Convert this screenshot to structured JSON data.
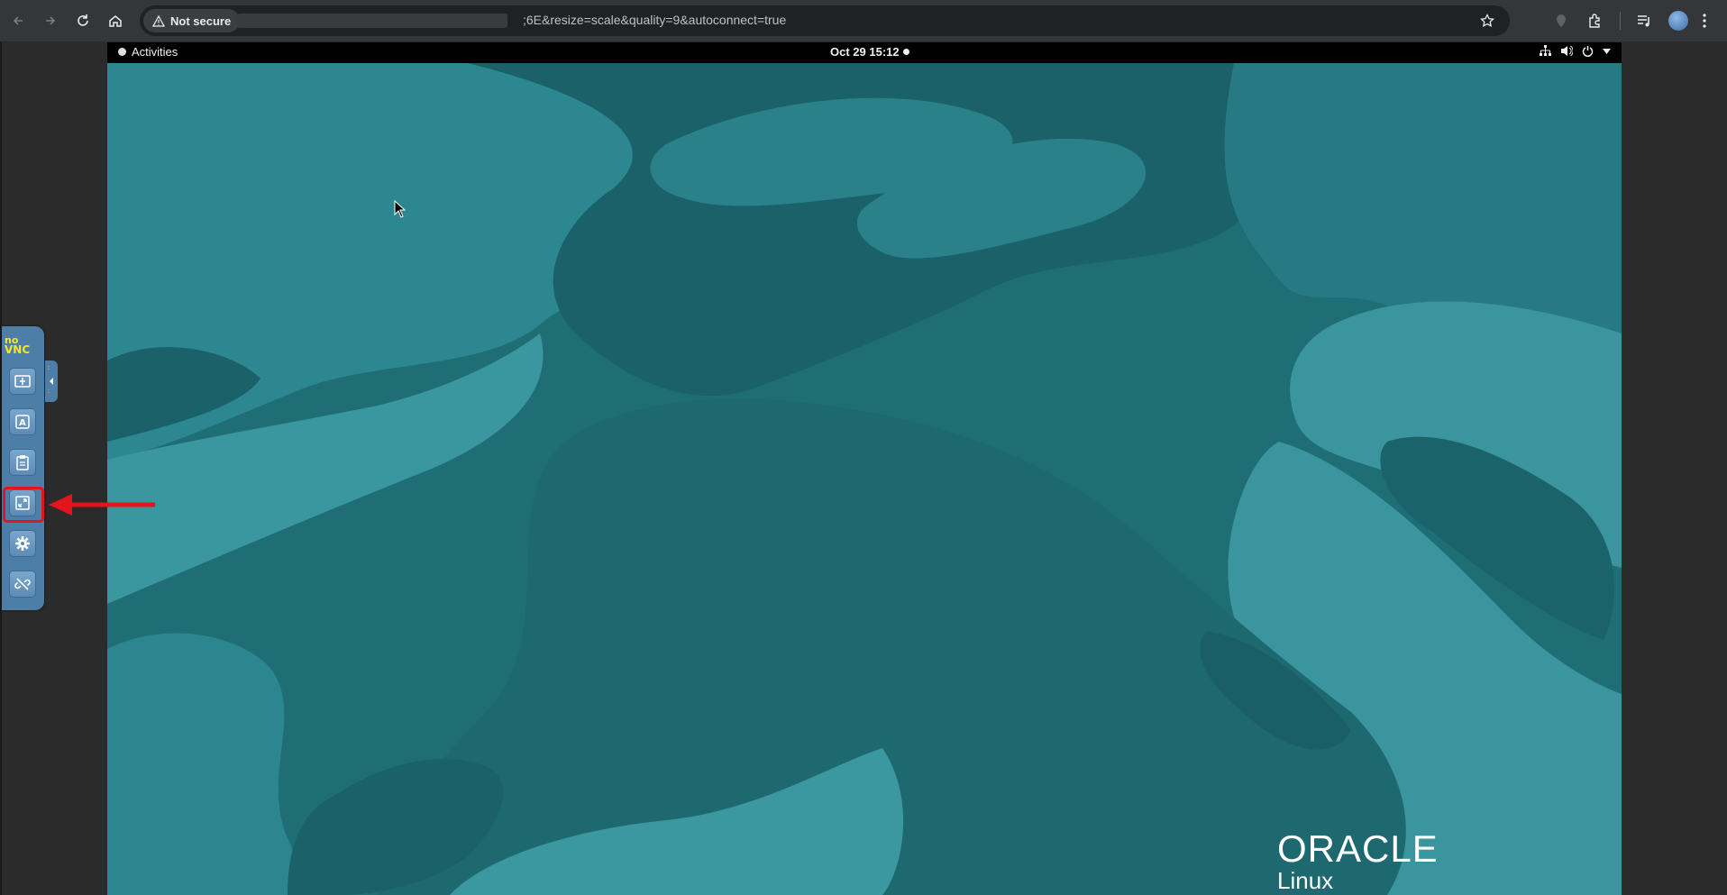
{
  "browser": {
    "security_label": "Not secure",
    "url_visible": "​;6E&resize=scale&quality=9&autoconnect=true",
    "icons": [
      "back-icon",
      "forward-icon",
      "reload-icon",
      "home-icon",
      "warning-icon",
      "star-icon",
      "location-icon",
      "extensions-icon",
      "media-icon",
      "avatar",
      "menu-icon"
    ]
  },
  "gnome": {
    "activities_label": "Activities",
    "clock": "Oct 29  15:12",
    "tray_icons": [
      "network-icon",
      "volume-icon",
      "power-icon",
      "chevron-down-icon"
    ]
  },
  "wallpaper": {
    "brand": "ORACLE",
    "product": "Linux",
    "colors": {
      "base": "#1f6e76",
      "light": "#2e8a93",
      "dark": "#195e66",
      "lighter": "#3c9ba3"
    }
  },
  "novnc": {
    "logo_top": "no",
    "logo_bottom": "VNC",
    "buttons": [
      "drag-viewport",
      "extra-keys",
      "clipboard",
      "fullscreen",
      "settings",
      "disconnect"
    ],
    "highlighted": "fullscreen",
    "highlight_color": "#e3141b"
  }
}
